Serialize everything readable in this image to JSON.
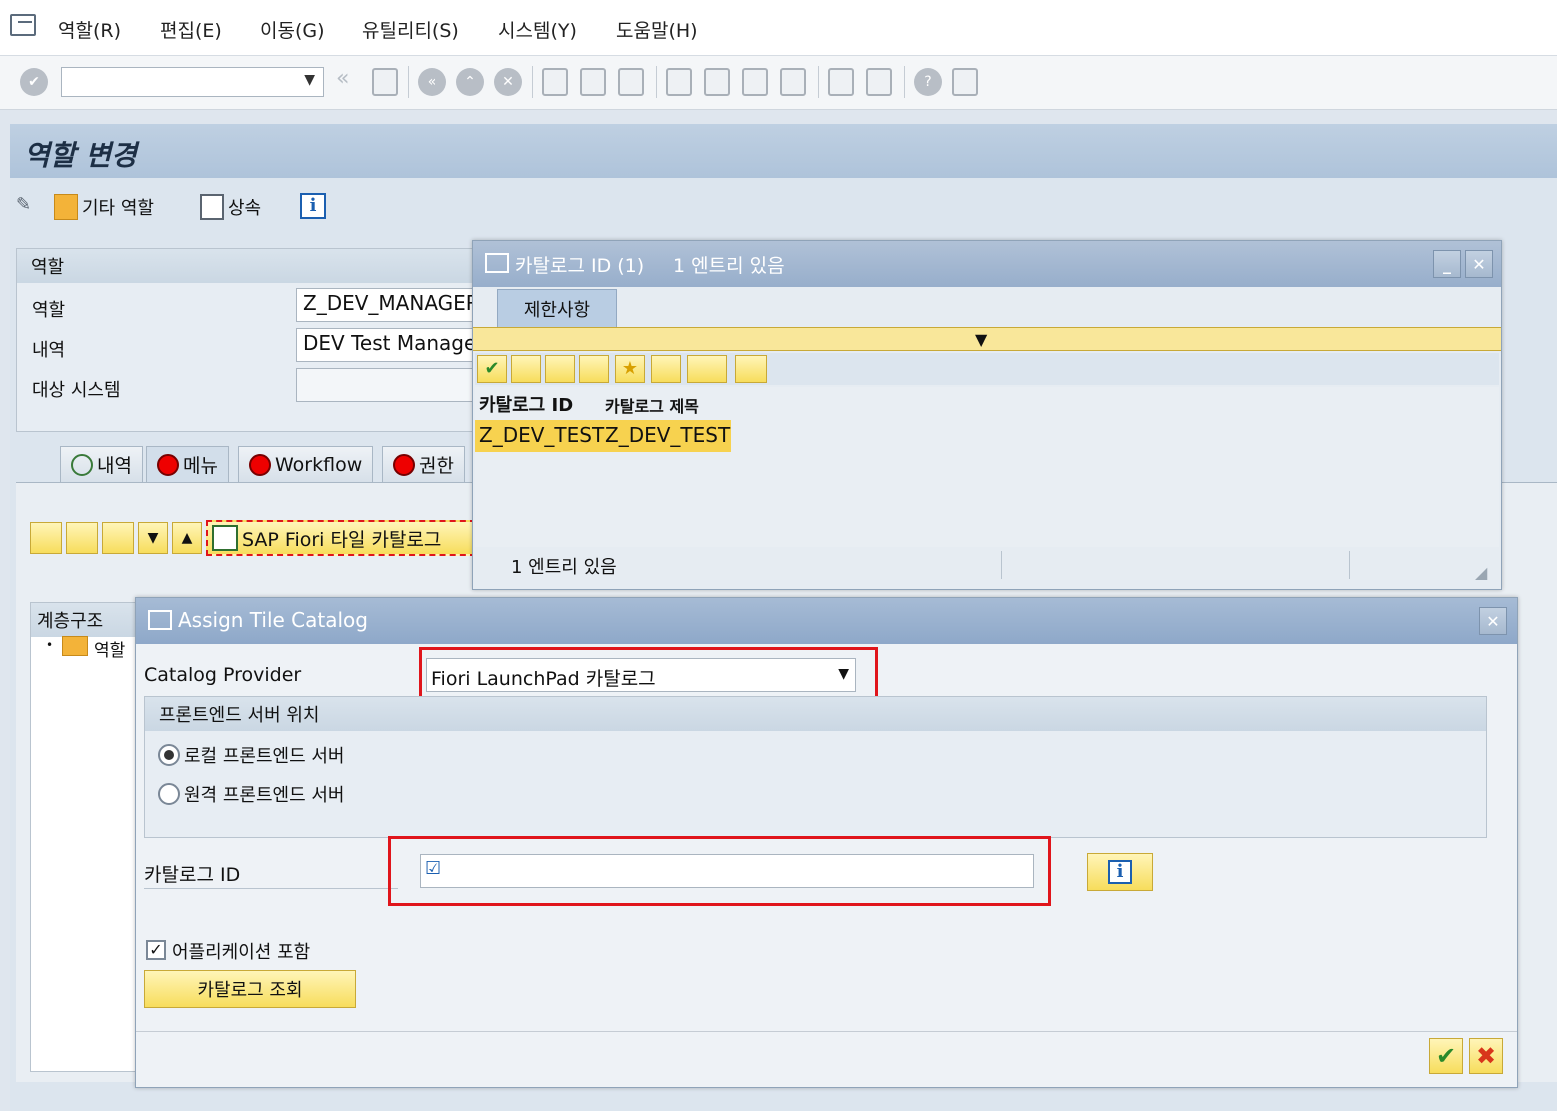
{
  "menu": {
    "items": [
      "역할(R)",
      "편집(E)",
      "이동(G)",
      "유틸리티(S)",
      "시스템(Y)",
      "도움말(H)"
    ]
  },
  "toolbar": {
    "command_field_value": ""
  },
  "page": {
    "title": "역할 변경"
  },
  "app_toolbar": {
    "other_role": "기타 역할",
    "inherit": "상속"
  },
  "role_group": {
    "header": "역할",
    "labels": {
      "role": "역할",
      "description": "내역",
      "target_system": "대상 시스템"
    },
    "values": {
      "role": "Z_DEV_MANAGER",
      "description": "DEV Test Manager",
      "target_system": ""
    }
  },
  "tabs": [
    {
      "label": "내역",
      "status": "green"
    },
    {
      "label": "메뉴",
      "status": "red"
    },
    {
      "label": "Workflow",
      "status": "red"
    },
    {
      "label": "권한",
      "status": "red"
    }
  ],
  "menu_tab": {
    "fiori_button": "SAP Fiori 타일 카탈로그",
    "hierarchy_header": "계층구조",
    "hierarchy_root": "역할"
  },
  "catalog_popup": {
    "title": "카탈로그 ID (1)",
    "title_count": "1 엔트리 있음",
    "restriction_tab": "제한사항",
    "columns": [
      "카탈로그 ID",
      "카탈로그 제목"
    ],
    "rows": [
      [
        "Z_DEV_TEST",
        "Z_DEV_TEST"
      ]
    ],
    "status": "1 엔트리 있음"
  },
  "assign_popup": {
    "title": "Assign Tile Catalog",
    "catalog_provider_label": "Catalog Provider",
    "catalog_provider_value": "Fiori LaunchPad 카탈로그",
    "frontend_group_header": "프론트엔드 서버 위치",
    "radio_local": "로컬 프론트엔드 서버",
    "radio_remote": "원격 프론트엔드 서버",
    "catalog_id_label": "카탈로그 ID",
    "catalog_id_value": "",
    "include_apps_label": "어플리케이션 포함",
    "search_button": "카탈로그 조회"
  },
  "colors": {
    "highlight_red": "#e0151b",
    "yellow_button": "#f7dd5c",
    "title_blue": "#97aecb"
  }
}
